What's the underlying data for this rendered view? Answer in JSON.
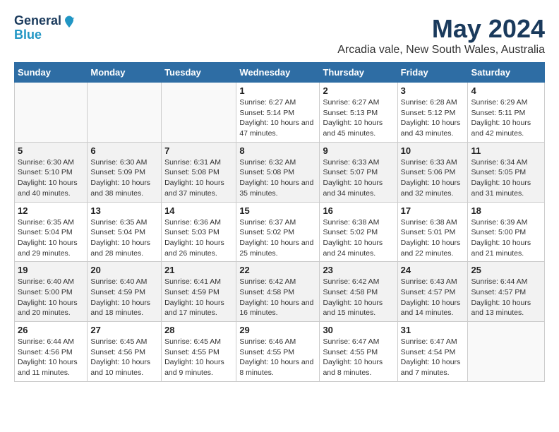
{
  "header": {
    "logo_line1": "General",
    "logo_line2": "Blue",
    "title": "May 2024",
    "subtitle": "Arcadia vale, New South Wales, Australia"
  },
  "days_of_week": [
    "Sunday",
    "Monday",
    "Tuesday",
    "Wednesday",
    "Thursday",
    "Friday",
    "Saturday"
  ],
  "weeks": [
    [
      {
        "day": "",
        "info": ""
      },
      {
        "day": "",
        "info": ""
      },
      {
        "day": "",
        "info": ""
      },
      {
        "day": "1",
        "info": "Sunrise: 6:27 AM\nSunset: 5:14 PM\nDaylight: 10 hours and 47 minutes."
      },
      {
        "day": "2",
        "info": "Sunrise: 6:27 AM\nSunset: 5:13 PM\nDaylight: 10 hours and 45 minutes."
      },
      {
        "day": "3",
        "info": "Sunrise: 6:28 AM\nSunset: 5:12 PM\nDaylight: 10 hours and 43 minutes."
      },
      {
        "day": "4",
        "info": "Sunrise: 6:29 AM\nSunset: 5:11 PM\nDaylight: 10 hours and 42 minutes."
      }
    ],
    [
      {
        "day": "5",
        "info": "Sunrise: 6:30 AM\nSunset: 5:10 PM\nDaylight: 10 hours and 40 minutes."
      },
      {
        "day": "6",
        "info": "Sunrise: 6:30 AM\nSunset: 5:09 PM\nDaylight: 10 hours and 38 minutes."
      },
      {
        "day": "7",
        "info": "Sunrise: 6:31 AM\nSunset: 5:08 PM\nDaylight: 10 hours and 37 minutes."
      },
      {
        "day": "8",
        "info": "Sunrise: 6:32 AM\nSunset: 5:08 PM\nDaylight: 10 hours and 35 minutes."
      },
      {
        "day": "9",
        "info": "Sunrise: 6:33 AM\nSunset: 5:07 PM\nDaylight: 10 hours and 34 minutes."
      },
      {
        "day": "10",
        "info": "Sunrise: 6:33 AM\nSunset: 5:06 PM\nDaylight: 10 hours and 32 minutes."
      },
      {
        "day": "11",
        "info": "Sunrise: 6:34 AM\nSunset: 5:05 PM\nDaylight: 10 hours and 31 minutes."
      }
    ],
    [
      {
        "day": "12",
        "info": "Sunrise: 6:35 AM\nSunset: 5:04 PM\nDaylight: 10 hours and 29 minutes."
      },
      {
        "day": "13",
        "info": "Sunrise: 6:35 AM\nSunset: 5:04 PM\nDaylight: 10 hours and 28 minutes."
      },
      {
        "day": "14",
        "info": "Sunrise: 6:36 AM\nSunset: 5:03 PM\nDaylight: 10 hours and 26 minutes."
      },
      {
        "day": "15",
        "info": "Sunrise: 6:37 AM\nSunset: 5:02 PM\nDaylight: 10 hours and 25 minutes."
      },
      {
        "day": "16",
        "info": "Sunrise: 6:38 AM\nSunset: 5:02 PM\nDaylight: 10 hours and 24 minutes."
      },
      {
        "day": "17",
        "info": "Sunrise: 6:38 AM\nSunset: 5:01 PM\nDaylight: 10 hours and 22 minutes."
      },
      {
        "day": "18",
        "info": "Sunrise: 6:39 AM\nSunset: 5:00 PM\nDaylight: 10 hours and 21 minutes."
      }
    ],
    [
      {
        "day": "19",
        "info": "Sunrise: 6:40 AM\nSunset: 5:00 PM\nDaylight: 10 hours and 20 minutes."
      },
      {
        "day": "20",
        "info": "Sunrise: 6:40 AM\nSunset: 4:59 PM\nDaylight: 10 hours and 18 minutes."
      },
      {
        "day": "21",
        "info": "Sunrise: 6:41 AM\nSunset: 4:59 PM\nDaylight: 10 hours and 17 minutes."
      },
      {
        "day": "22",
        "info": "Sunrise: 6:42 AM\nSunset: 4:58 PM\nDaylight: 10 hours and 16 minutes."
      },
      {
        "day": "23",
        "info": "Sunrise: 6:42 AM\nSunset: 4:58 PM\nDaylight: 10 hours and 15 minutes."
      },
      {
        "day": "24",
        "info": "Sunrise: 6:43 AM\nSunset: 4:57 PM\nDaylight: 10 hours and 14 minutes."
      },
      {
        "day": "25",
        "info": "Sunrise: 6:44 AM\nSunset: 4:57 PM\nDaylight: 10 hours and 13 minutes."
      }
    ],
    [
      {
        "day": "26",
        "info": "Sunrise: 6:44 AM\nSunset: 4:56 PM\nDaylight: 10 hours and 11 minutes."
      },
      {
        "day": "27",
        "info": "Sunrise: 6:45 AM\nSunset: 4:56 PM\nDaylight: 10 hours and 10 minutes."
      },
      {
        "day": "28",
        "info": "Sunrise: 6:45 AM\nSunset: 4:55 PM\nDaylight: 10 hours and 9 minutes."
      },
      {
        "day": "29",
        "info": "Sunrise: 6:46 AM\nSunset: 4:55 PM\nDaylight: 10 hours and 8 minutes."
      },
      {
        "day": "30",
        "info": "Sunrise: 6:47 AM\nSunset: 4:55 PM\nDaylight: 10 hours and 8 minutes."
      },
      {
        "day": "31",
        "info": "Sunrise: 6:47 AM\nSunset: 4:54 PM\nDaylight: 10 hours and 7 minutes."
      },
      {
        "day": "",
        "info": ""
      }
    ]
  ]
}
